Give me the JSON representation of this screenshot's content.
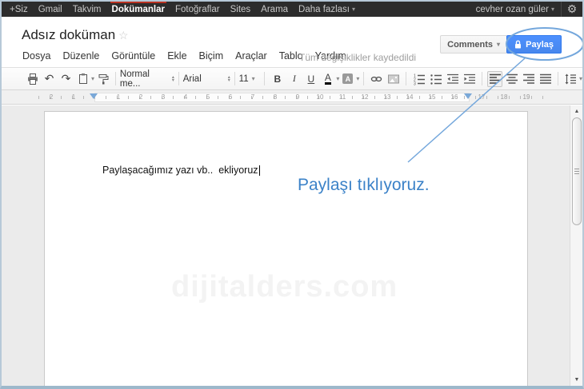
{
  "topbar": {
    "items": [
      "+Siz",
      "Gmail",
      "Takvim",
      "Dokümanlar",
      "Fotoğraflar",
      "Sites",
      "Arama",
      "Daha fazlası"
    ],
    "active_item": "Dokümanlar",
    "user": "cevher ozan güler",
    "icons": {
      "gear": "⚙",
      "caret": "▾"
    }
  },
  "header": {
    "title": "Adsız doküman",
    "star_icon": "☆",
    "menu": [
      "Dosya",
      "Düzenle",
      "Görüntüle",
      "Ekle",
      "Biçim",
      "Araçlar",
      "Tablo",
      "Yardım"
    ],
    "save_status": "Tüm değişiklikler kaydedildi",
    "comments_label": "Comments",
    "share_label": "Paylaş",
    "share_color": "#4d90fe"
  },
  "toolbar": {
    "style_value": "Normal me...",
    "font_value": "Arial",
    "size_value": "11",
    "bold": "B",
    "italic": "I",
    "underline": "U",
    "text_color": "A",
    "highlight_letter": "A",
    "undo_glyph": "↶",
    "redo_glyph": "↷",
    "icons": [
      "print-icon",
      "undo-icon",
      "redo-icon",
      "paste-icon",
      "paint-format-icon",
      "bold",
      "italic",
      "underline",
      "text-color",
      "highlight-color-icon",
      "insert-link-icon",
      "insert-image-icon",
      "numbered-list-icon",
      "bulleted-list-icon",
      "decrease-indent-icon",
      "increase-indent-icon",
      "align-left-icon",
      "align-center-icon",
      "align-right-icon",
      "justify-icon",
      "line-spacing-icon"
    ],
    "active_alignment": "left"
  },
  "ruler": {
    "left_numbers": [
      "2",
      "1"
    ],
    "numbers": [
      "1",
      "2",
      "3",
      "4",
      "5",
      "6",
      "7",
      "8",
      "9",
      "10",
      "11",
      "12",
      "13",
      "14",
      "15",
      "16"
    ],
    "right_numbers": [
      "17",
      "18",
      "19"
    ]
  },
  "document": {
    "text": "Paylaşacağımız yazı vb..  ekliyoruz",
    "watermark": "dijitalders.com"
  },
  "annotation": {
    "text": "Paylaşı tıklıyoruz.",
    "color": "#3b82c8",
    "line_color": "#74a7dc"
  },
  "scrollbar": {
    "up": "▲",
    "down": "▼"
  }
}
